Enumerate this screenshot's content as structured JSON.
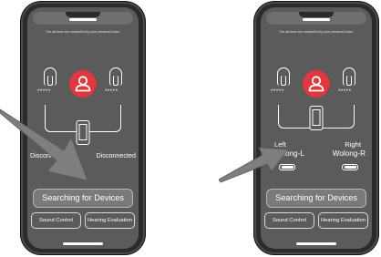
{
  "screens": [
    {
      "hint": "The devices are controlled by your personal voice.",
      "left_status": "Disconnected",
      "right_status": "Disconnected",
      "dots": "*****",
      "primary_button": "Searching for Devices",
      "sound_control": "Sound Control",
      "hearing_evaluation": "Hearing Evaluation"
    },
    {
      "hint": "The devices are controlled by your personal voice.",
      "left_title": "Left",
      "left_name": "Wolong-L",
      "right_title": "Right",
      "right_name": "Wolong-R",
      "dots": "*****",
      "primary_button": "Searching for Devices",
      "sound_control": "Sound Control",
      "hearing_evaluation": "Hearing Evaluation"
    }
  ],
  "colors": {
    "phone_body": "#2b2b2b",
    "screen": "#5b5b5b",
    "avatar_accent": "#e0373f",
    "arrow": "#7e7e7e"
  },
  "icons": [
    "hearing-aid-icon",
    "user-avatar-icon",
    "smartphone-icon",
    "battery-icon",
    "pointer-arrow"
  ]
}
